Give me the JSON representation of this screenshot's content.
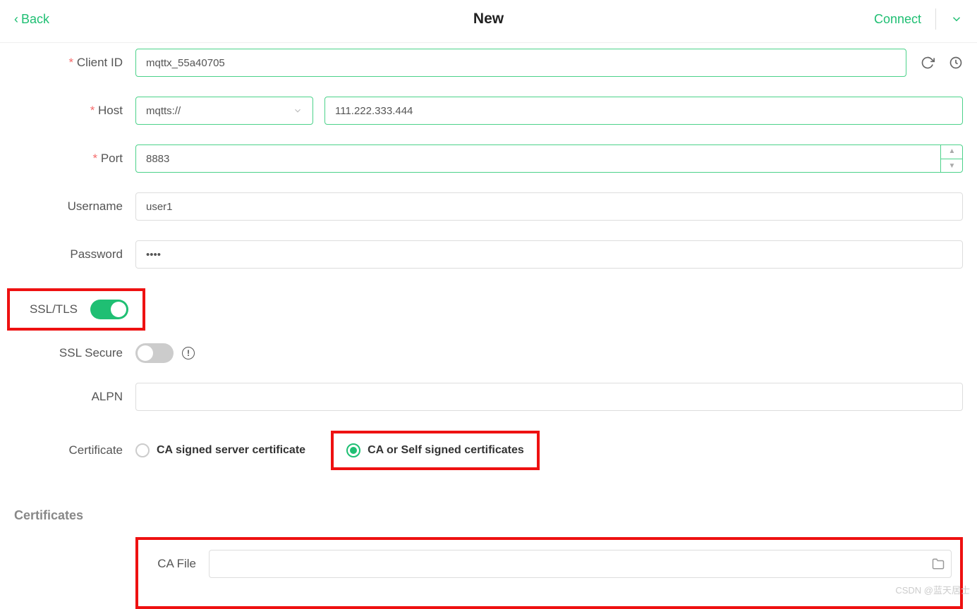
{
  "header": {
    "back": "Back",
    "title": "New",
    "connect": "Connect"
  },
  "form": {
    "clientId": {
      "label": "Client ID",
      "value": "mqttx_55a40705"
    },
    "host": {
      "label": "Host",
      "protocol": "mqtts://",
      "address": "111.222.333.444"
    },
    "port": {
      "label": "Port",
      "value": "8883"
    },
    "username": {
      "label": "Username",
      "value": "user1"
    },
    "password": {
      "label": "Password",
      "value": "••••"
    },
    "sslTls": {
      "label": "SSL/TLS",
      "on": true
    },
    "sslSecure": {
      "label": "SSL Secure",
      "on": false
    },
    "alpn": {
      "label": "ALPN",
      "value": ""
    },
    "certificate": {
      "label": "Certificate",
      "option1": "CA signed server certificate",
      "option2": "CA or Self signed certificates",
      "selected": 2
    }
  },
  "certificatesSection": {
    "title": "Certificates",
    "caFile": {
      "label": "CA File",
      "value": ""
    }
  },
  "watermark": "CSDN @蓝天居士"
}
